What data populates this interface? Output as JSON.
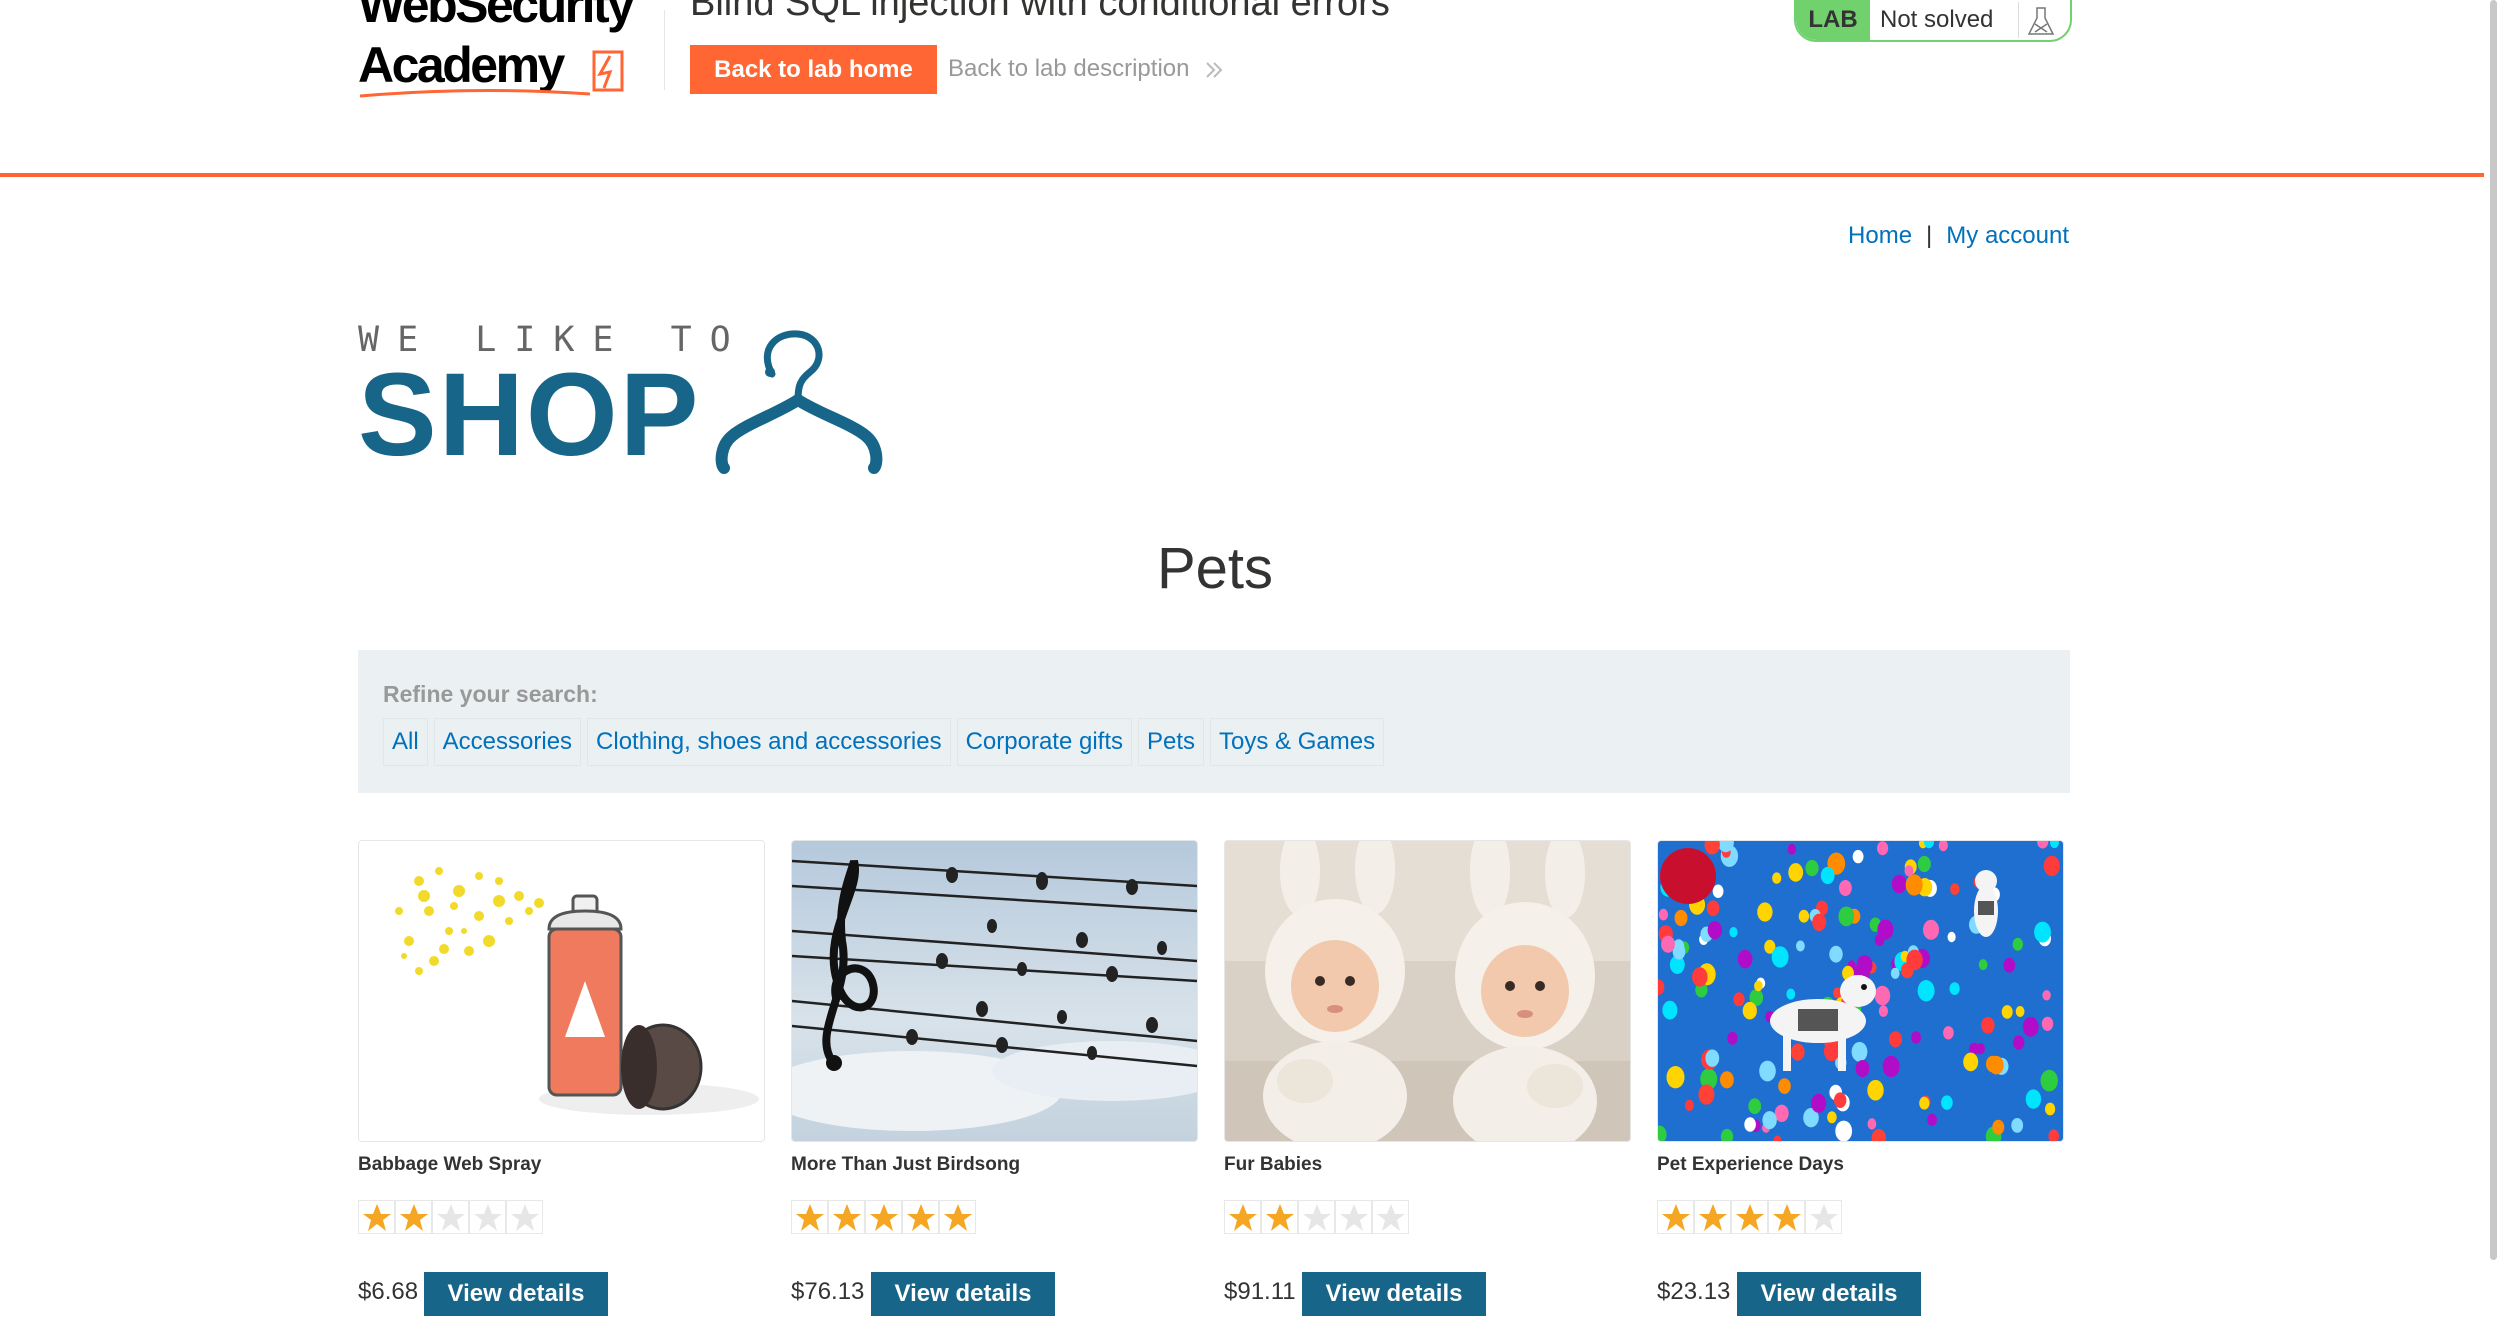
{
  "academy": {
    "logo_line1": "WebSecurity",
    "logo_line2": "Academy",
    "lab_title": "Blind SQL injection with conditional errors",
    "back_home_label": "Back to lab home",
    "back_desc_label": "Back to lab description",
    "lab_badge": "LAB",
    "lab_status": "Not solved",
    "colors": {
      "orange": "#ff6633",
      "green": "#70d16d"
    }
  },
  "nav": {
    "home": "Home",
    "separator": "|",
    "my_account": "My account"
  },
  "shop_logo": {
    "tagline": "WE LIKE TO",
    "word": "SHOP",
    "color": "#176589"
  },
  "category_title": "Pets",
  "refine": {
    "label": "Refine your search:",
    "filters": [
      "All",
      "Accessories",
      "Clothing, shoes and accessories",
      "Corporate gifts",
      "Pets",
      "Toys & Games"
    ]
  },
  "products": [
    {
      "name": "Babbage Web Spray",
      "rating": 2,
      "max_rating": 5,
      "price": "$6.68",
      "button": "View details",
      "image": "spray-can"
    },
    {
      "name": "More Than Just Birdsong",
      "rating": 5,
      "max_rating": 5,
      "price": "$76.13",
      "button": "View details",
      "image": "birds-on-wires"
    },
    {
      "name": "Fur Babies",
      "rating": 2,
      "max_rating": 5,
      "price": "$91.11",
      "button": "View details",
      "image": "babies-in-bunny-hats"
    },
    {
      "name": "Pet Experience Days",
      "rating": 4,
      "max_rating": 5,
      "price": "$23.13",
      "button": "View details",
      "image": "dogs-with-balloons"
    }
  ]
}
